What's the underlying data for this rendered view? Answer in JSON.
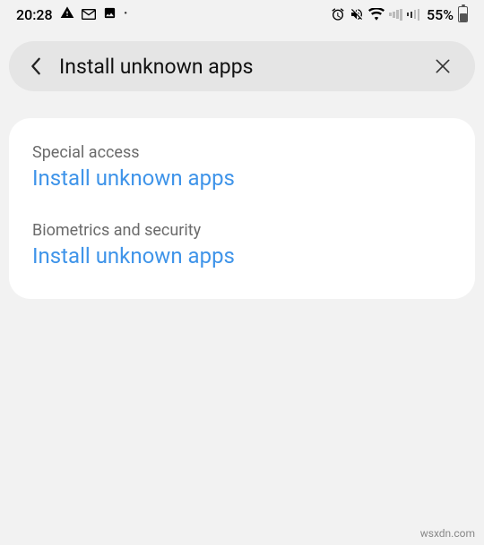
{
  "status_bar": {
    "time": "20:28",
    "icons_left": [
      "warning",
      "gmail",
      "image",
      "dot"
    ],
    "icons_right": [
      "alarm",
      "mute",
      "wifi",
      "signal1",
      "signal2"
    ],
    "battery_percent": "55%"
  },
  "search": {
    "query": "Install unknown apps"
  },
  "results": [
    {
      "category": "Special access",
      "title": "Install unknown apps"
    },
    {
      "category": "Biometrics and security",
      "title": "Install unknown apps"
    }
  ],
  "watermark": "wsxdn.com"
}
